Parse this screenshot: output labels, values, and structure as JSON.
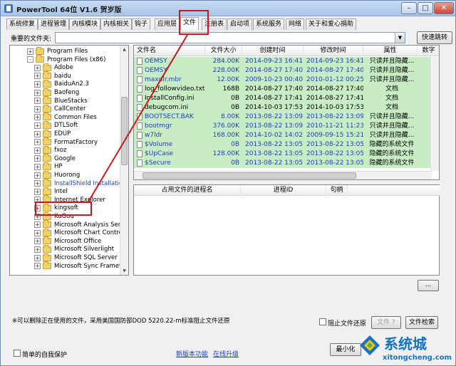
{
  "window": {
    "title": "PowerTool 64位 V1.6 贺岁版"
  },
  "colors": {
    "selection_green": "#c8ecc4",
    "link_blue": "#1e3ec7",
    "annotation_red": "#c8191f",
    "watermark_blue": "#1673c2"
  },
  "tabs": [
    "系统修复",
    "进程管理",
    "内核模块",
    "内核相关",
    "钩子",
    "应用层",
    "文件",
    "注册表",
    "启动项",
    "系统服务",
    "网络",
    "关于和爱心捐助"
  ],
  "active_tab": "文件",
  "path": {
    "label": "重要的文件夹:",
    "value": "",
    "quick_jump": "快速跳转"
  },
  "tree": [
    {
      "label": "Program Files",
      "expander": "+",
      "blue": false
    },
    {
      "label": "Program Files (x86)",
      "expander": "-",
      "blue": false
    },
    {
      "label": "Adobe",
      "expander": "+",
      "blue": false
    },
    {
      "label": "baidu",
      "expander": "+",
      "blue": false
    },
    {
      "label": "BaiduAn2.3",
      "expander": "+",
      "blue": false
    },
    {
      "label": "Baofeng",
      "expander": "+",
      "blue": false
    },
    {
      "label": "BlueStacks",
      "expander": "+",
      "blue": false
    },
    {
      "label": "CallCenter",
      "expander": "+",
      "blue": false
    },
    {
      "label": "Common Files",
      "expander": "+",
      "blue": false
    },
    {
      "label": "DTLSoft",
      "expander": "+",
      "blue": false
    },
    {
      "label": "EDUP",
      "expander": "+",
      "blue": false
    },
    {
      "label": "FormatFactory",
      "expander": "+",
      "blue": false
    },
    {
      "label": "fxoz",
      "expander": "+",
      "blue": false
    },
    {
      "label": "Google",
      "expander": "+",
      "blue": false
    },
    {
      "label": "HP",
      "expander": "+",
      "blue": false
    },
    {
      "label": "Huorong",
      "expander": "+",
      "blue": false
    },
    {
      "label": "InstallShield Installation",
      "expander": "+",
      "blue": true
    },
    {
      "label": "Intel",
      "expander": "+",
      "blue": false
    },
    {
      "label": "Internet Explorer",
      "expander": "+",
      "blue": false
    },
    {
      "label": "kingsoft",
      "expander": "+",
      "blue": false
    },
    {
      "label": "KuGou",
      "expander": "+",
      "blue": false
    },
    {
      "label": "Microsoft Analysis Servi",
      "expander": "+",
      "blue": false
    },
    {
      "label": "Microsoft Chart Control",
      "expander": "+",
      "blue": false
    },
    {
      "label": "Microsoft Office",
      "expander": "+",
      "blue": false
    },
    {
      "label": "Microsoft Silverlight",
      "expander": "+",
      "blue": false
    },
    {
      "label": "Microsoft SQL Server C",
      "expander": "+",
      "blue": false
    },
    {
      "label": "Microsoft Sync Framew",
      "expander": "+",
      "blue": false
    }
  ],
  "file_columns": [
    "文件名",
    "文件大小",
    "创建时间",
    "修改时间",
    "属性",
    "数字"
  ],
  "files": [
    {
      "name": "OEMSY",
      "size": "284.00K",
      "created": "2014-09-23 16:41",
      "modified": "2014-09-23 16:41",
      "attr": "只读并且隐藏...",
      "blue": true
    },
    {
      "name": "OEMSY",
      "size": "228.00K",
      "created": "2014-08-27 17:40",
      "modified": "2014-08-27 17:40",
      "attr": "只读并且隐藏...",
      "blue": true
    },
    {
      "name": "maxdlr.mbr",
      "size": "12.00K",
      "created": "2009-10-23 00:40",
      "modified": "2010-01-12 00:25",
      "attr": "只读并且隐藏...",
      "blue": true
    },
    {
      "name": "log_followvideo.txt",
      "size": "168B",
      "created": "2014-08-27 17:40",
      "modified": "2014-08-27 17:40",
      "attr": "文档",
      "blue": false
    },
    {
      "name": "InstallConfig.ini",
      "size": "0B",
      "created": "2014-08-27 17:41",
      "modified": "2014-08-27 17:41",
      "attr": "文档",
      "blue": false
    },
    {
      "name": "debugcom.ini",
      "size": "0B",
      "created": "2014-10-03 17:53",
      "modified": "2014-10-03 17:53",
      "attr": "文档",
      "blue": false
    },
    {
      "name": "BOOTSECT.BAK",
      "size": "8.00K",
      "created": "2013-08-22 13:09",
      "modified": "2013-08-22 13:09",
      "attr": "只读并且隐藏...",
      "blue": true
    },
    {
      "name": "bootmgr",
      "size": "376.00K",
      "created": "2013-08-22 13:09",
      "modified": "2010-11-21 11:23",
      "attr": "只读并且隐藏...",
      "blue": true
    },
    {
      "name": "w7ldr",
      "size": "168.00K",
      "created": "2014-10-02 14:02",
      "modified": "2009-09-15 15:21",
      "attr": "只读并且隐藏...",
      "blue": true
    },
    {
      "name": "$Volume",
      "size": "0B",
      "created": "2013-08-22 13:05",
      "modified": "2013-08-22 13:05",
      "attr": "隐藏的系统文件",
      "blue": true
    },
    {
      "name": "$UpCase",
      "size": "128.00K",
      "created": "2013-08-22 13:05",
      "modified": "2013-08-22 13:05",
      "attr": "隐藏的系统文件",
      "blue": true
    },
    {
      "name": "$Secure",
      "size": "0B",
      "created": "2013-08-22 13:05",
      "modified": "2013-08-22 13:05",
      "attr": "隐藏的系统文件",
      "blue": true
    }
  ],
  "proc_columns": [
    "占用文件的进程名",
    "进程ID",
    "句柄"
  ],
  "bottom": {
    "more": "...",
    "note": "※可以删除正在使用的文件，采用美国国防部DOD 5220.22-m标准阻止文件还原",
    "prevent_restore": "阻止文件还原",
    "file_btn": "文件 ?",
    "file_search": "文件检索",
    "self_protect": "简单的自我保护",
    "new_features": "新版本功能",
    "online_upgrade": "在线升级",
    "minimize": "最小化"
  },
  "watermark": {
    "big": "系统城",
    "small": "xitongcheng.com"
  }
}
